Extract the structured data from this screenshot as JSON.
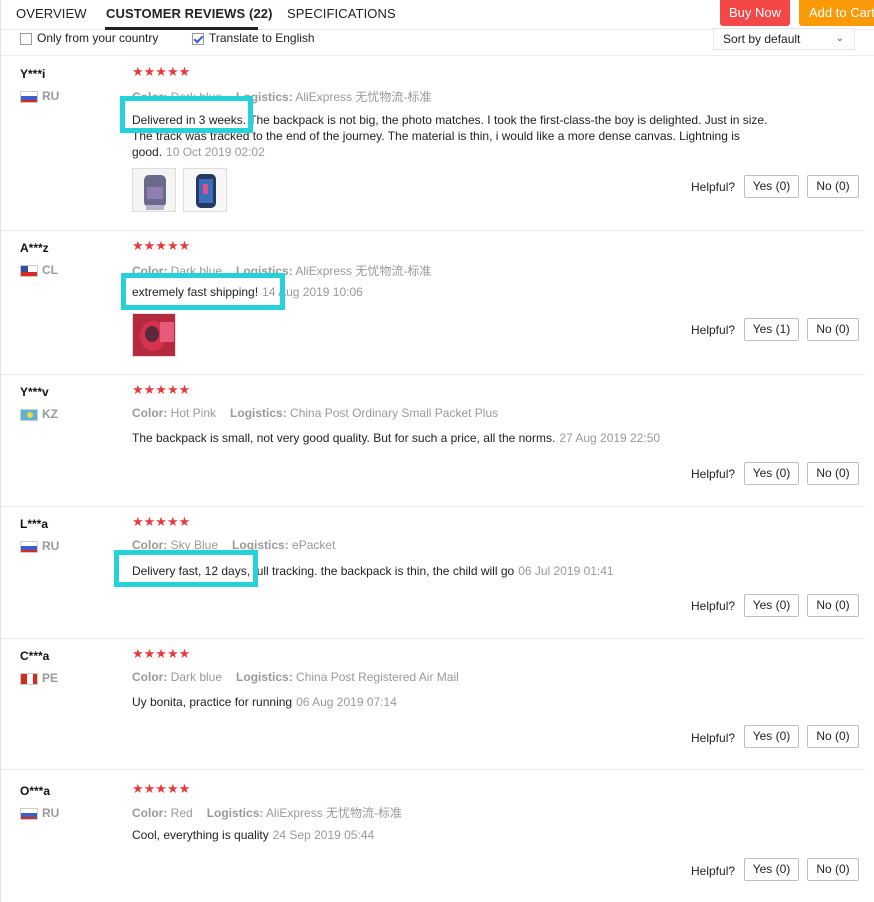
{
  "tabs": {
    "overview": "OVERVIEW",
    "reviews": "CUSTOMER REVIEWS (22)",
    "specs": "SPECIFICATIONS"
  },
  "actions": {
    "buy_now": "Buy Now",
    "add_to_cart": "Add to Cart"
  },
  "filters": {
    "only_country": {
      "label": "Only from your country",
      "checked": false
    },
    "translate": {
      "label": "Translate to English",
      "checked": true
    },
    "sort": {
      "value": "Sort by default"
    }
  },
  "labels": {
    "color": "Color:",
    "logistics": "Logistics:",
    "helpful": "Helpful?"
  },
  "reviews": [
    {
      "name": "Y***i",
      "country": "RU",
      "stars": "★★★★★",
      "color": "Dark blue",
      "logistics": "AliExpress 无忧物流-标准",
      "text": "Delivered in 3 weeks. The backpack is not big, the photo matches. I took the first-class-the boy is delighted. Just in size. The track was tracked to the end of the journey. The material is thin, i would like a more dense canvas. Lightning is good.",
      "date": "10 Oct 2019 02:02",
      "yes": "Yes (0)",
      "no": "No (0)"
    },
    {
      "name": "A***z",
      "country": "CL",
      "stars": "★★★★★",
      "color": "Dark blue",
      "logistics": "AliExpress 无忧物流-标准",
      "text": "extremely fast shipping!",
      "date": "14 Aug 2019 10:06",
      "yes": "Yes (1)",
      "no": "No (0)"
    },
    {
      "name": "Y***v",
      "country": "KZ",
      "stars": "★★★★★",
      "color": "Hot Pink",
      "logistics": "China Post Ordinary Small Packet Plus",
      "text": "The backpack is small, not very good quality. But for such a price, all the norms.",
      "date": "27 Aug 2019 22:50",
      "yes": "Yes (0)",
      "no": "No (0)"
    },
    {
      "name": "L***a",
      "country": "RU",
      "stars": "★★★★★",
      "color": "Sky Blue",
      "logistics": "ePacket",
      "text": "Delivery fast, 12 days, full tracking. the backpack is thin, the child will go",
      "date": "06 Jul 2019 01:41",
      "yes": "Yes (0)",
      "no": "No (0)"
    },
    {
      "name": "C***a",
      "country": "PE",
      "stars": "★★★★★",
      "color": "Dark blue",
      "logistics": "China Post Registered Air Mail",
      "text": "Uy bonita, practice for running",
      "date": "06 Aug 2019 07:14",
      "yes": "Yes (0)",
      "no": "No (0)"
    },
    {
      "name": "O***a",
      "country": "RU",
      "stars": "★★★★★",
      "color": "Red",
      "logistics": "AliExpress 无忧物流-标准",
      "text": "Cool, everything is quality",
      "date": "24 Sep 2019 05:44",
      "yes": "Yes (0)",
      "no": "No (0)"
    }
  ],
  "colors": {
    "buy_now": "#f44848",
    "add_to_cart": "#fb9a09",
    "stars": "#e83a3a",
    "highlight": "#26d2d9"
  }
}
